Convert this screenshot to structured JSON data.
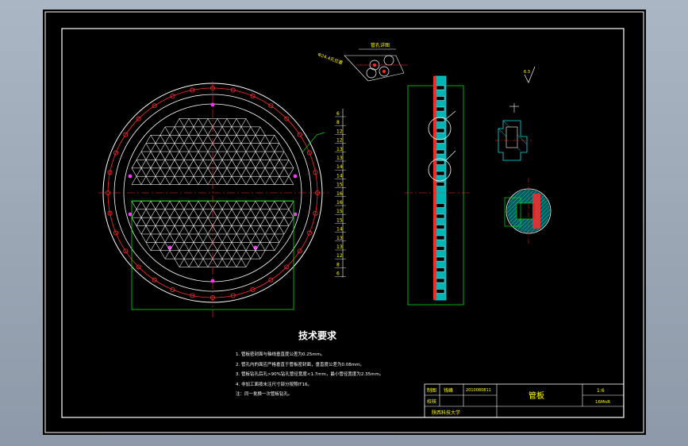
{
  "tech_requirements": {
    "title": "技术要求",
    "items": [
      "1. 管板密封面与轴线垂直度公差为0.25mm。",
      "2. 管孔内的面应严格垂直于管板密封面，垂直度公差为0.08mm。",
      "3. 管板钻孔后孔>90%钻孔管径宽度<1.7mm，最小管径宽度为2.35mm。",
      "4. 非加工面按未注尺寸部分按照IT16。",
      "注：同一批换一次管板钻孔。"
    ]
  },
  "title_block": {
    "r1c1": "制图",
    "r1c2": "钱峰",
    "r1c3": "2010080811",
    "r2c1": "校核",
    "drawing_name": "管板",
    "scale": "1:6",
    "material": "16MnR",
    "school": "陕西科技大学"
  },
  "detail_label": "管孔详图",
  "note_label": "Φ24.4孔位置",
  "roughness": "6.3",
  "part_numbers": [
    "6",
    "8",
    "12",
    "12",
    "13",
    "13",
    "14",
    "14",
    "15",
    "16",
    "16",
    "15",
    "15",
    "14",
    "13",
    "13",
    "12",
    "8",
    "6"
  ],
  "colors": {
    "frame": "#ffffff",
    "outline": "#ff2b2b",
    "green": "#00e000",
    "cyan": "#00e5e5",
    "yellow": "#ffff00",
    "magenta": "#ff33ff"
  }
}
